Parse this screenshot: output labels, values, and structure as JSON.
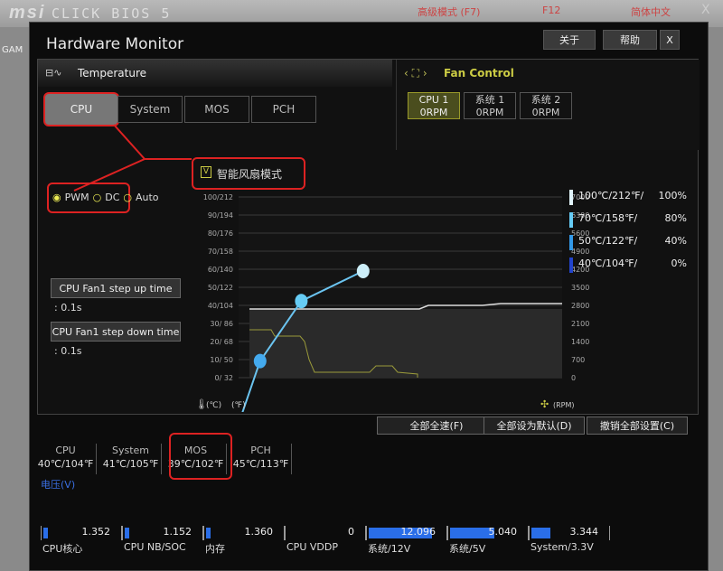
{
  "topbar": {
    "brand": "msi",
    "product": "CLICK BIOS 5",
    "mode": "高级模式 (F7)",
    "screenshot_key": "F12",
    "language": "简体中文",
    "close": "X",
    "side_label": "GAM"
  },
  "window": {
    "title": "Hardware Monitor",
    "about": "关于",
    "help": "帮助",
    "close": "X"
  },
  "temperature": {
    "header": "Temperature",
    "tabs": [
      "CPU",
      "System",
      "MOS",
      "PCH"
    ],
    "selected_tab": "CPU",
    "modes": [
      "PWM",
      "DC",
      "Auto"
    ],
    "selected_mode": "PWM",
    "step_up_label": "CPU Fan1 step up time",
    "step_up_value": ": 0.1s",
    "step_down_label": "CPU Fan1 step down time",
    "step_down_value": ": 0.1s",
    "smart_fan_label": "智能风扇模式",
    "smart_fan_checked": true,
    "checkbox_mark": "V"
  },
  "fan_control": {
    "header": "Fan Control",
    "fans": [
      {
        "name": "CPU 1",
        "rpm": "0RPM",
        "selected": true
      },
      {
        "name": "系统 1",
        "rpm": "0RPM"
      },
      {
        "name": "系统 2",
        "rpm": "0RPM"
      }
    ]
  },
  "chart_data": {
    "type": "line",
    "left_ticks": [
      "100/212",
      "90/194",
      "80/176",
      "70/158",
      "60/140",
      "50/122",
      "40/104",
      "30/ 86",
      "20/ 68",
      "10/ 50",
      "0/ 32"
    ],
    "right_ticks": [
      "7000",
      "6300",
      "5600",
      "4900",
      "4200",
      "3500",
      "2800",
      "2100",
      "1400",
      "700",
      "0"
    ],
    "left_unit_c": "(℃)",
    "left_unit_f": "(℉)",
    "right_unit": "(RPM)",
    "curve_points": [
      {
        "temp_c": 40,
        "percent": 0,
        "color": "#2244cc"
      },
      {
        "temp_c": 50,
        "percent": 40,
        "color": "#44aaee"
      },
      {
        "temp_c": 70,
        "percent": 80,
        "color": "#66ccf5"
      },
      {
        "temp_c": 100,
        "percent": 100,
        "color": "#cceef8"
      }
    ],
    "legend": [
      {
        "label": "100℃/212℉/",
        "percent": "100%",
        "color": "#e0f4fa"
      },
      {
        "label": "70℃/158℉/",
        "percent": "80%",
        "color": "#66ccf5"
      },
      {
        "label": "50℃/122℉/",
        "percent": "40%",
        "color": "#3399e8"
      },
      {
        "label": "40℃/104℉/",
        "percent": "0%",
        "color": "#2244cc"
      }
    ]
  },
  "actions": {
    "full_speed": "全部全速(F)",
    "set_default": "全部设为默认(D)",
    "cancel_all": "撤销全部设置(C)"
  },
  "temps": [
    {
      "name": "CPU",
      "value": "40℃/104℉"
    },
    {
      "name": "System",
      "value": "41℃/105℉"
    },
    {
      "name": "MOS",
      "value": "39℃/102℉"
    },
    {
      "name": "PCH",
      "value": "45℃/113℉"
    }
  ],
  "voltage": {
    "header": "电压(V)",
    "items": [
      {
        "name": "CPU核心",
        "value": "1.352",
        "fill": 0.05
      },
      {
        "name": "CPU NB/SOC",
        "value": "1.152",
        "fill": 0.05
      },
      {
        "name": "内存",
        "value": "1.360",
        "fill": 0.05
      },
      {
        "name": "CPU VDDP",
        "value": "0",
        "fill": 0
      },
      {
        "name": "系统/12V",
        "value": "12.096",
        "fill": 1
      },
      {
        "name": "系统/5V",
        "value": "5.040",
        "fill": 0.7
      },
      {
        "name": "System/3.3V",
        "value": "3.344",
        "fill": 0.3
      }
    ]
  },
  "colors": {
    "accent": "#d22222",
    "selected_fan": "#4a4d1e",
    "voltage_bar": "#2a6ee8"
  }
}
